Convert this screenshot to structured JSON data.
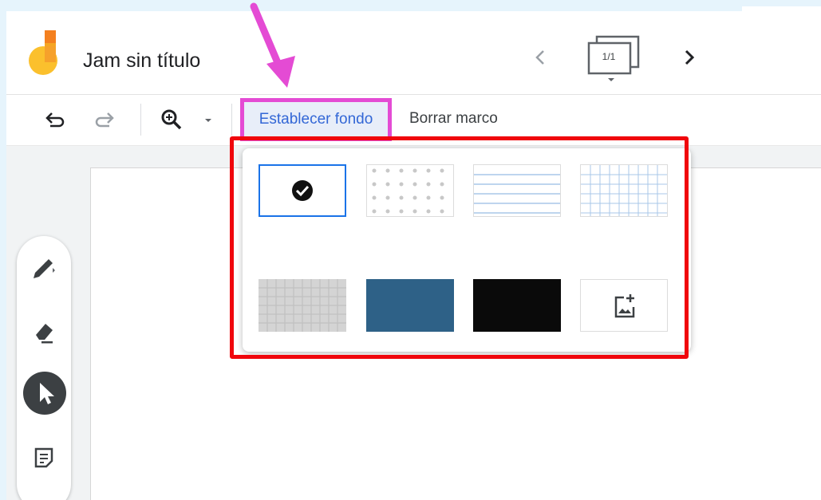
{
  "header": {
    "title": "Jam sin título",
    "frame_counter": "1/1"
  },
  "toolbar": {
    "set_background_label": "Establecer fondo",
    "clear_frame_label": "Borrar marco"
  },
  "background_options": [
    {
      "name": "blank",
      "selected": true
    },
    {
      "name": "dots",
      "selected": false
    },
    {
      "name": "lined",
      "selected": false
    },
    {
      "name": "grid",
      "selected": false
    },
    {
      "name": "gray-grid",
      "selected": false
    },
    {
      "name": "blue",
      "selected": false
    },
    {
      "name": "black",
      "selected": false
    },
    {
      "name": "upload-image",
      "selected": false
    }
  ],
  "colors": {
    "highlight_pink": "#e44bd4",
    "highlight_red": "#f0060c",
    "accent_blue": "#3367d6",
    "option_blue": "#2e6187",
    "option_black": "#0a0a0a"
  },
  "icons": {
    "undo": "undo-icon",
    "redo": "redo-icon",
    "zoom": "zoom-in-icon",
    "pen": "pen-icon",
    "eraser": "eraser-icon",
    "select": "select-cursor-icon",
    "sticky_note": "sticky-note-icon",
    "add_image": "add-image-icon"
  }
}
